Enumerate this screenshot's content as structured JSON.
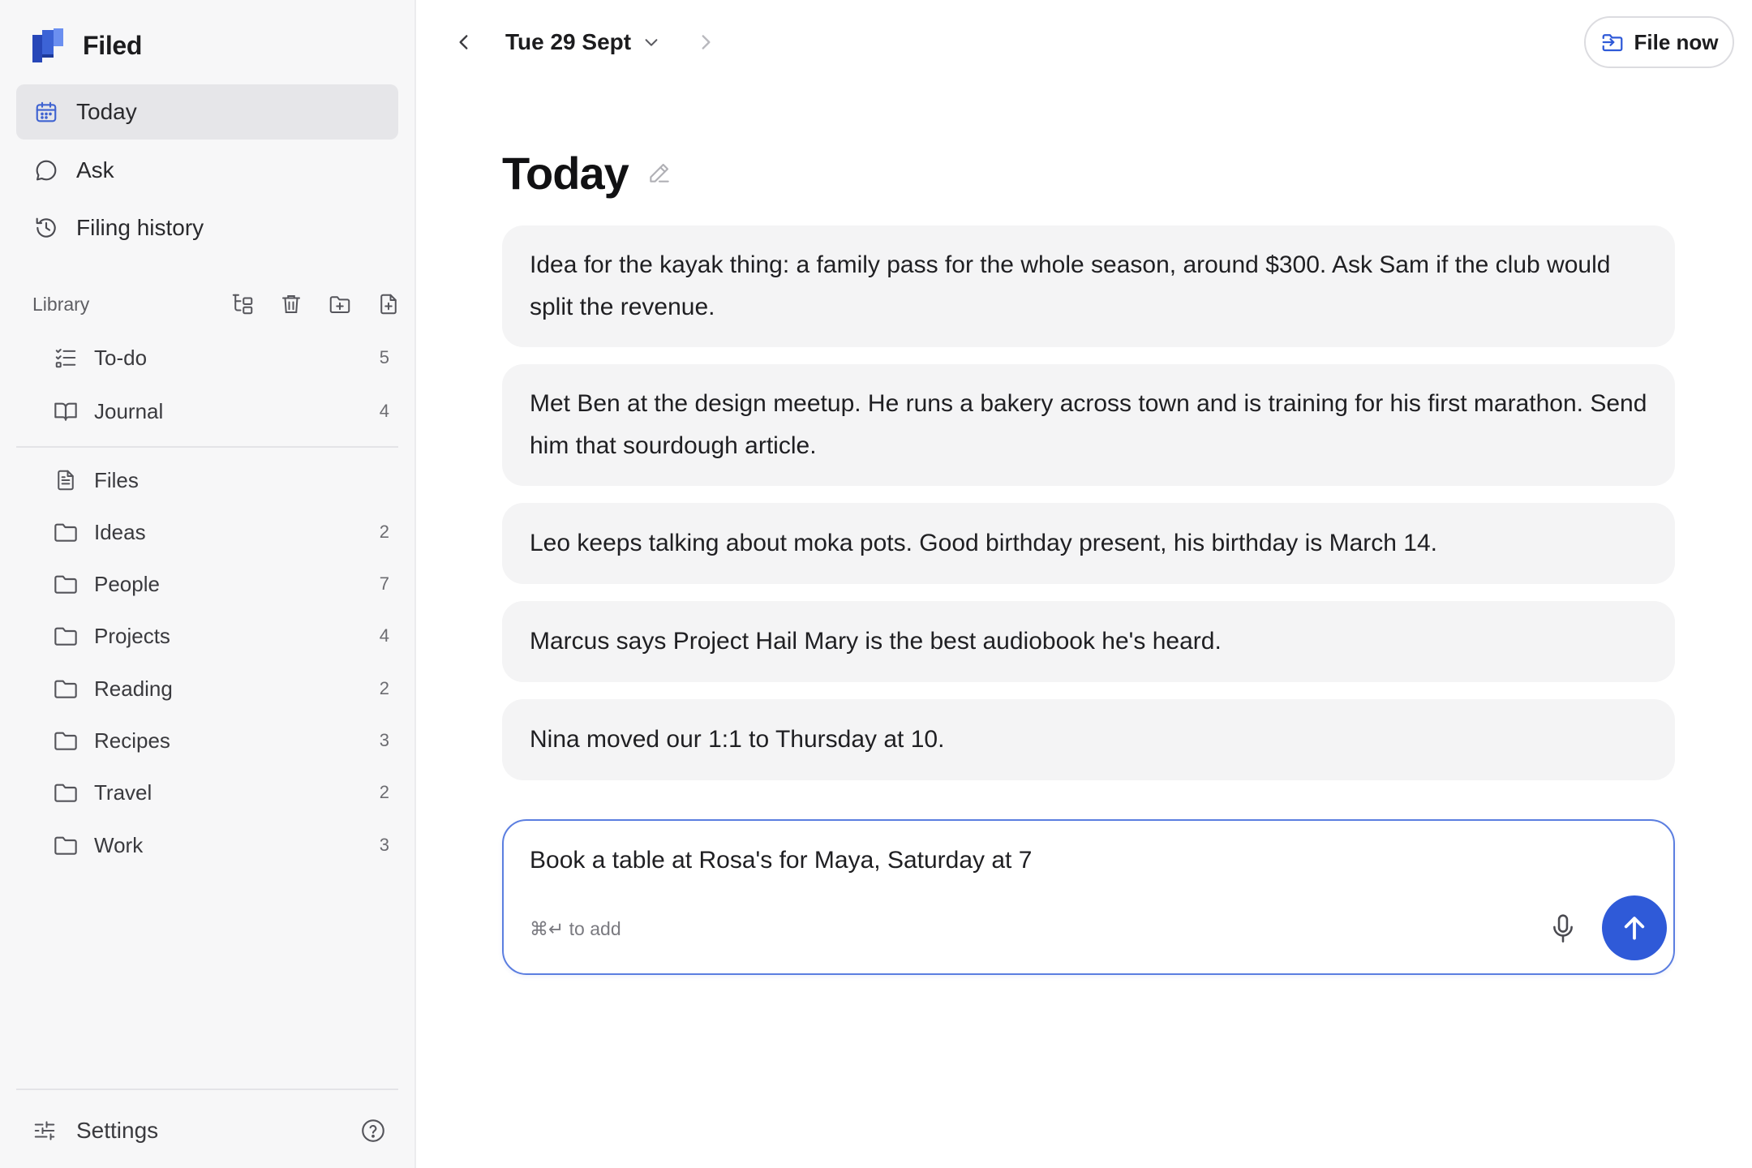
{
  "app": {
    "name": "Filed"
  },
  "sidebar": {
    "nav": [
      {
        "label": "Today",
        "icon": "calendar-icon",
        "active": true
      },
      {
        "label": "Ask",
        "icon": "chat-bubble-icon",
        "active": false
      },
      {
        "label": "Filing history",
        "icon": "history-icon",
        "active": false
      }
    ],
    "library": {
      "title": "Library",
      "actions": [
        "tree-view-icon",
        "trash-icon",
        "new-folder-icon",
        "new-file-icon"
      ],
      "pinned": [
        {
          "label": "To-do",
          "icon": "checklist-icon",
          "count": "5"
        },
        {
          "label": "Journal",
          "icon": "book-icon",
          "count": "4"
        }
      ],
      "folders": [
        {
          "label": "Files",
          "icon": "file-icon",
          "count": ""
        },
        {
          "label": "Ideas",
          "icon": "folder-icon",
          "count": "2"
        },
        {
          "label": "People",
          "icon": "folder-icon",
          "count": "7"
        },
        {
          "label": "Projects",
          "icon": "folder-icon",
          "count": "4"
        },
        {
          "label": "Reading",
          "icon": "folder-icon",
          "count": "2"
        },
        {
          "label": "Recipes",
          "icon": "folder-icon",
          "count": "3"
        },
        {
          "label": "Travel",
          "icon": "folder-icon",
          "count": "2"
        },
        {
          "label": "Work",
          "icon": "folder-icon",
          "count": "3"
        }
      ]
    },
    "settings": {
      "label": "Settings",
      "icon": "sliders-icon",
      "help_icon": "help-circle-icon"
    }
  },
  "topbar": {
    "date": "Tue 29 Sept",
    "file_now": "File now"
  },
  "main": {
    "title": "Today",
    "notes": [
      {
        "text": "Idea for the kayak thing: a family pass for the whole season, around $300. Ask Sam if the club would split the revenue."
      },
      {
        "text": "Met Ben at the design meetup. He runs a bakery across town and is training for his first marathon. Send him that sourdough article."
      },
      {
        "text": "Leo keeps talking about moka pots. Good birthday present, his birthday is March 14."
      },
      {
        "text": "Marcus says Project Hail Mary is the best audiobook he's heard."
      },
      {
        "text": "Nina moved our 1:1 to Thursday at 10."
      }
    ]
  },
  "composer": {
    "value": "Book a table at Rosa's for Maya, Saturday at 7",
    "hint": "⌘↵ to add"
  },
  "colors": {
    "accent": "#2f5ad8",
    "composer_border": "#5b7ee0",
    "sidebar_bg": "#f7f7f8",
    "note_bg": "#f4f4f5",
    "active_nav_bg": "#e6e6e9"
  }
}
